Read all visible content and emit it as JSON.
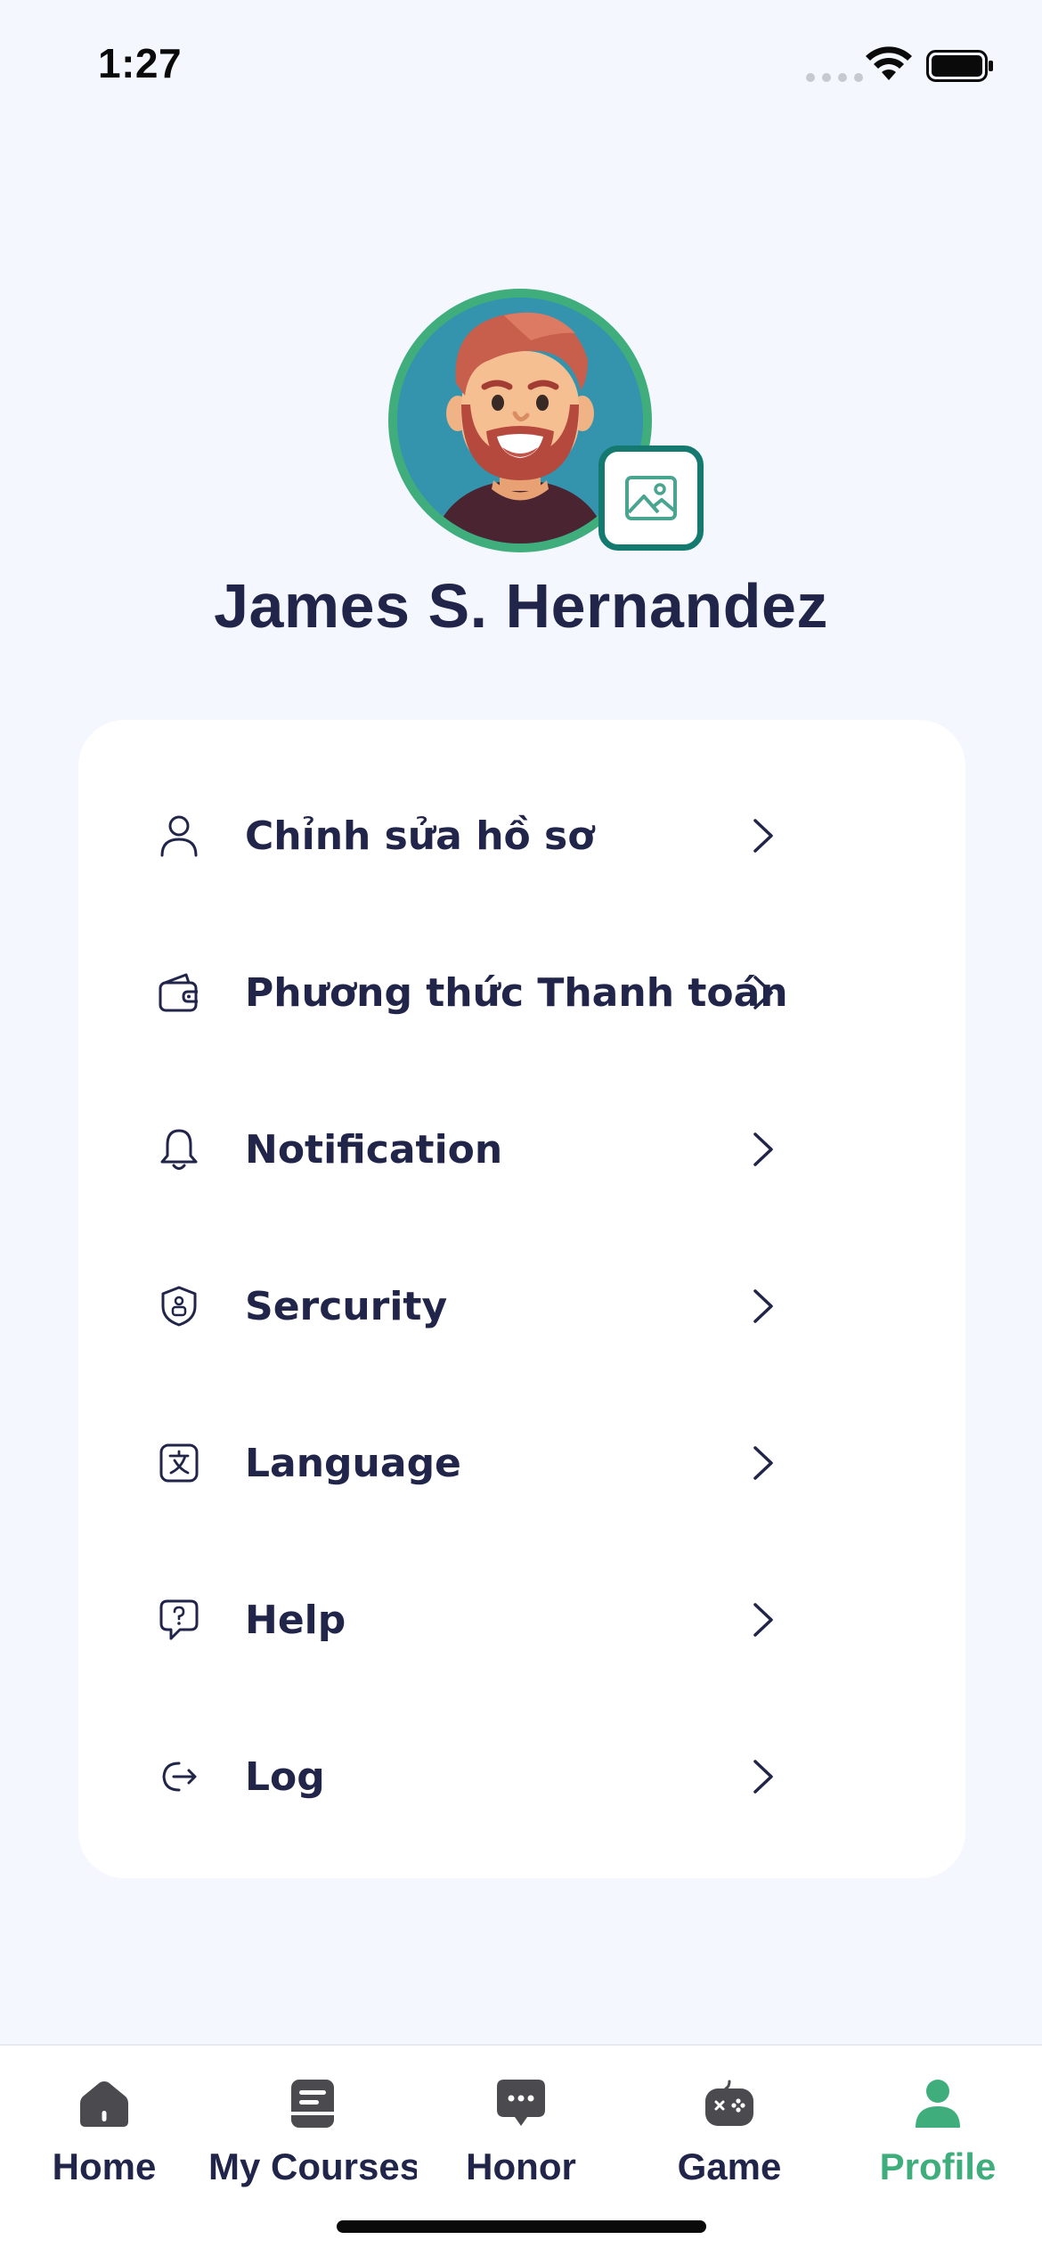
{
  "status_bar": {
    "time": "1:27"
  },
  "profile": {
    "name": "James S. Hernandez"
  },
  "menu": {
    "items": [
      {
        "label": "Chỉnh sửa hồ sơ",
        "icon": "user-icon"
      },
      {
        "label": "Phương thức Thanh toán",
        "icon": "wallet-icon"
      },
      {
        "label": "Notification",
        "icon": "bell-icon"
      },
      {
        "label": "Sercurity",
        "icon": "shield-icon"
      },
      {
        "label": "Language",
        "icon": "translate-icon"
      },
      {
        "label": "Help",
        "icon": "help-chat-icon"
      },
      {
        "label": "Log",
        "icon": "logout-icon"
      }
    ]
  },
  "tab_bar": {
    "tabs": [
      {
        "label": "Home",
        "icon": "home-icon"
      },
      {
        "label": "My Courses",
        "icon": "book-icon"
      },
      {
        "label": "Honor",
        "icon": "chat-bubble-icon"
      },
      {
        "label": "Game",
        "icon": "gamepad-icon"
      },
      {
        "label": "Profile",
        "icon": "person-icon"
      }
    ],
    "active": "Profile"
  },
  "colors": {
    "accent": "#3fae7c",
    "text": "#22254a",
    "background": "#f4f7fd",
    "avatar_edit_border": "#147a6f"
  }
}
